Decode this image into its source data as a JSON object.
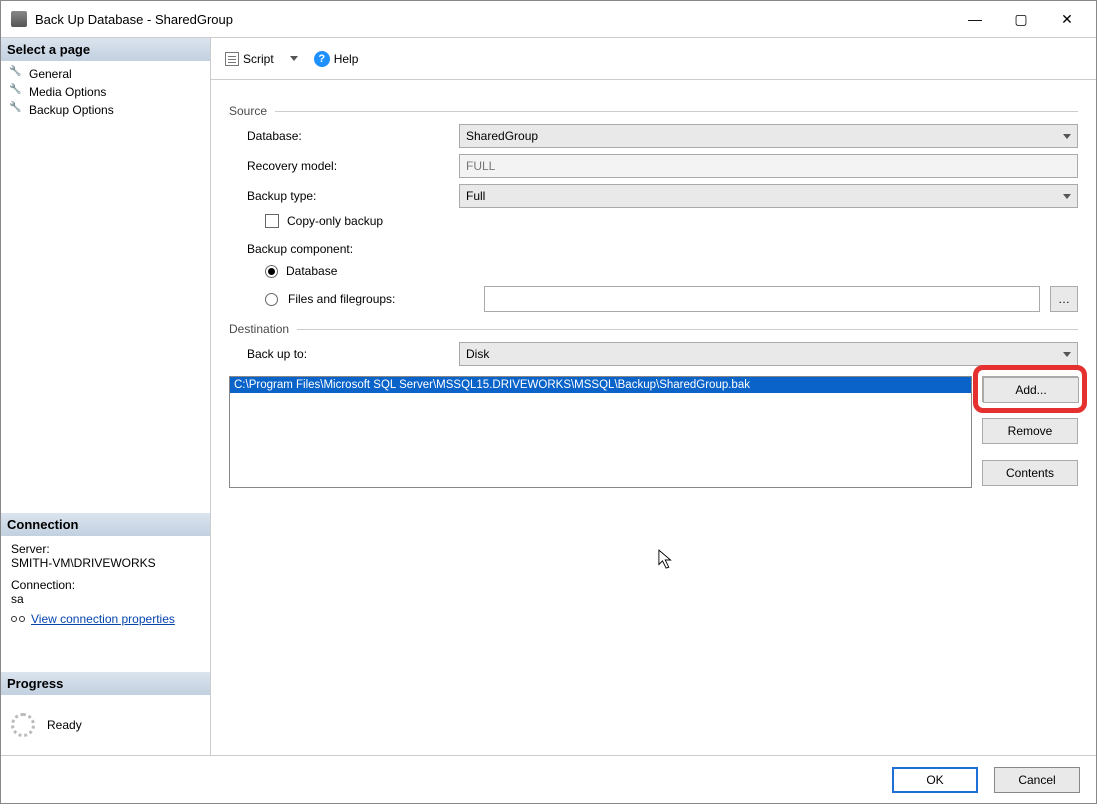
{
  "window": {
    "title": "Back Up Database - SharedGroup"
  },
  "sidebar": {
    "select_page_header": "Select a page",
    "items": [
      {
        "label": "General"
      },
      {
        "label": "Media Options"
      },
      {
        "label": "Backup Options"
      }
    ],
    "connection_header": "Connection",
    "server_label": "Server:",
    "server_value": "SMITH-VM\\DRIVEWORKS",
    "connection_label": "Connection:",
    "connection_value": "sa",
    "view_connection_link": "View connection properties",
    "progress_header": "Progress",
    "progress_value": "Ready"
  },
  "toolbar": {
    "script_label": "Script",
    "help_label": "Help"
  },
  "form": {
    "source_group": "Source",
    "database_label": "Database:",
    "database_value": "SharedGroup",
    "recovery_label": "Recovery model:",
    "recovery_value": "FULL",
    "backup_type_label": "Backup type:",
    "backup_type_value": "Full",
    "copy_only_label": "Copy-only backup",
    "backup_component_label": "Backup component:",
    "radio_database": "Database",
    "radio_filegroups": "Files and filegroups:",
    "destination_group": "Destination",
    "back_up_to_label": "Back up to:",
    "back_up_to_value": "Disk",
    "dest_item": "C:\\Program Files\\Microsoft SQL Server\\MSSQL15.DRIVEWORKS\\MSSQL\\Backup\\SharedGroup.bak",
    "add_btn": "Add...",
    "remove_btn": "Remove",
    "contents_btn": "Contents"
  },
  "footer": {
    "ok": "OK",
    "cancel": "Cancel"
  }
}
